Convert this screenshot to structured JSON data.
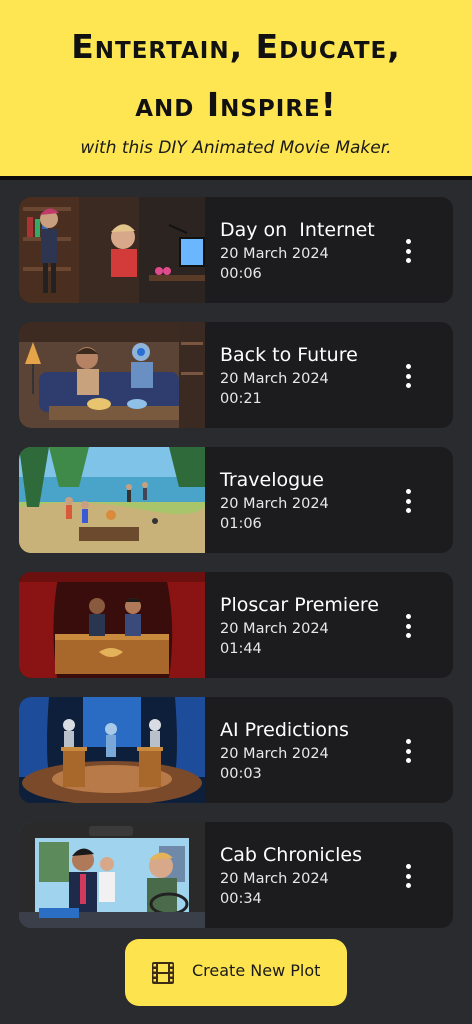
{
  "header": {
    "title_line1": "Entertain, Educate,",
    "title_line2": "and Inspire!",
    "subtitle": "with this DIY Animated Movie Maker."
  },
  "projects": [
    {
      "title": "Day on  Internet",
      "date": "20 March 2024",
      "duration": "00:06",
      "thumb": "office-desk-scene"
    },
    {
      "title": "Back to Future",
      "date": "20 March 2024",
      "duration": "00:21",
      "thumb": "living-room-robot-scene"
    },
    {
      "title": "Travelogue",
      "date": "20 March 2024",
      "duration": "01:06",
      "thumb": "lake-campfire-scene"
    },
    {
      "title": "Ploscar Premiere",
      "date": "20 March 2024",
      "duration": "01:44",
      "thumb": "red-curtain-stage-scene"
    },
    {
      "title": "AI Predictions",
      "date": "20 March 2024",
      "duration": "00:03",
      "thumb": "robot-debate-stage-scene"
    },
    {
      "title": "Cab Chronicles",
      "date": "20 March 2024",
      "duration": "00:34",
      "thumb": "taxi-interior-scene"
    }
  ],
  "cta": {
    "label": "Create New Plot",
    "icon": "film-strip-icon"
  },
  "colors": {
    "accent": "#fee653",
    "card": "#1c1c1e",
    "background": "#2a2b2f"
  }
}
